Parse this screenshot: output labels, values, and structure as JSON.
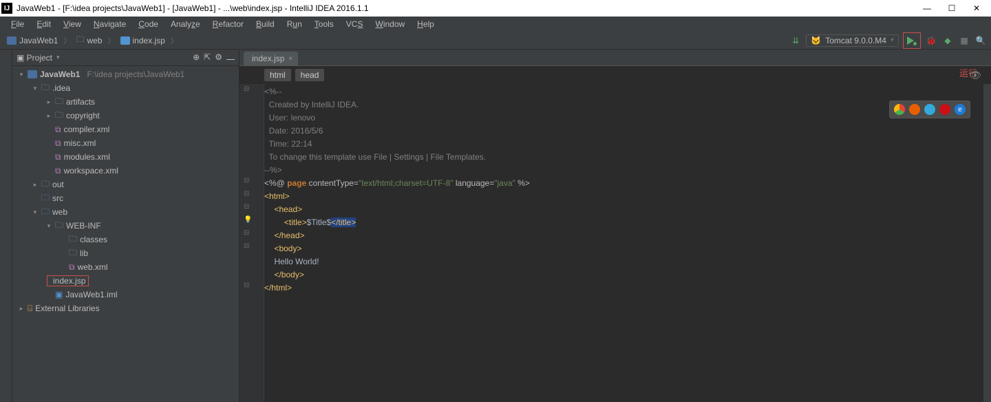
{
  "title": "JavaWeb1 - [F:\\idea projects\\JavaWeb1] - [JavaWeb1] - ...\\web\\index.jsp - IntelliJ IDEA 2016.1.1",
  "menu": [
    "File",
    "Edit",
    "View",
    "Navigate",
    "Code",
    "Analyze",
    "Refactor",
    "Build",
    "Run",
    "Tools",
    "VCS",
    "Window",
    "Help"
  ],
  "breadcrumb": {
    "project": "JavaWeb1",
    "folder": "web",
    "file": "index.jsp"
  },
  "runconfig": "Tomcat 9.0.0.M4",
  "project_panel": {
    "title": "Project"
  },
  "tree": {
    "root": "JavaWeb1",
    "root_path": "F:\\idea projects\\JavaWeb1",
    "idea": ".idea",
    "artifacts": "artifacts",
    "copyright": "copyright",
    "compiler": "compiler.xml",
    "misc": "misc.xml",
    "modules": "modules.xml",
    "workspace": "workspace.xml",
    "out": "out",
    "src": "src",
    "web": "web",
    "webinf": "WEB-INF",
    "classes": "classes",
    "lib": "lib",
    "webxml": "web.xml",
    "indexjsp": "index.jsp",
    "iml": "JavaWeb1.iml",
    "extlib": "External Libraries"
  },
  "tab": {
    "name": "index.jsp"
  },
  "sub_breadcrumb": [
    "html",
    "head"
  ],
  "annotation_run": "运行",
  "code": {
    "l1": "<%--",
    "l2": "  Created by IntelliJ IDEA.",
    "l3": "  User: lenovo",
    "l4": "  Date: 2016/5/6",
    "l5": "  Time: 22:14",
    "l6": "  To change this template use File | Settings | File Templates.",
    "l7": "--%>",
    "l8_tag": "<%@ ",
    "l8_dir": "page",
    "l8_attr1": " contentType=",
    "l8_str1": "\"text/html;charset=UTF-8\"",
    "l8_attr2": " language=",
    "l8_str2": "\"java\"",
    "l8_end": " %>",
    "l9": "<html>",
    "l10": "<head>",
    "l11o": "<title>",
    "l11t": "$Title$",
    "l11c": "</title>",
    "l12": "</head>",
    "l13": "<body>",
    "l14": "Hello World!",
    "l15": "</body>",
    "l16": "</html>"
  }
}
